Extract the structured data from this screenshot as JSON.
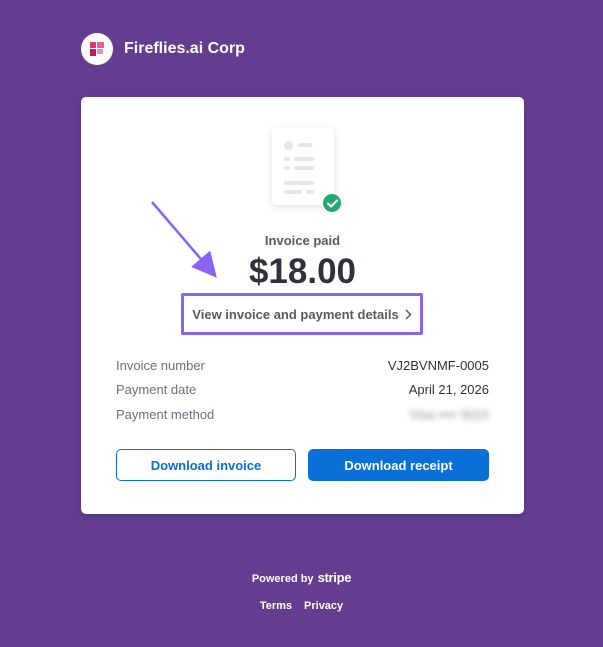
{
  "brand": {
    "name": "Fireflies.ai Corp",
    "logo_icon": "fireflies-logo-icon",
    "logo_color": "#e8336b"
  },
  "invoice": {
    "status": "Invoice paid",
    "amount": "$18.00",
    "view_link": "View invoice and payment details",
    "rows": [
      {
        "label": "Invoice number",
        "value": "VJ2BVNMF-0005"
      },
      {
        "label": "Payment date",
        "value": "April 21, 2026"
      },
      {
        "label": "Payment method",
        "value": "Visa •••• 3024"
      }
    ]
  },
  "actions": {
    "download_invoice": "Download invoice",
    "download_receipt": "Download receipt"
  },
  "footer": {
    "powered_by": "Powered by",
    "stripe": "stripe",
    "terms": "Terms",
    "privacy": "Privacy"
  },
  "colors": {
    "background": "#643d91",
    "accent": "#0a6fd6",
    "success": "#24a86b",
    "annotation": "#8a63f0"
  }
}
